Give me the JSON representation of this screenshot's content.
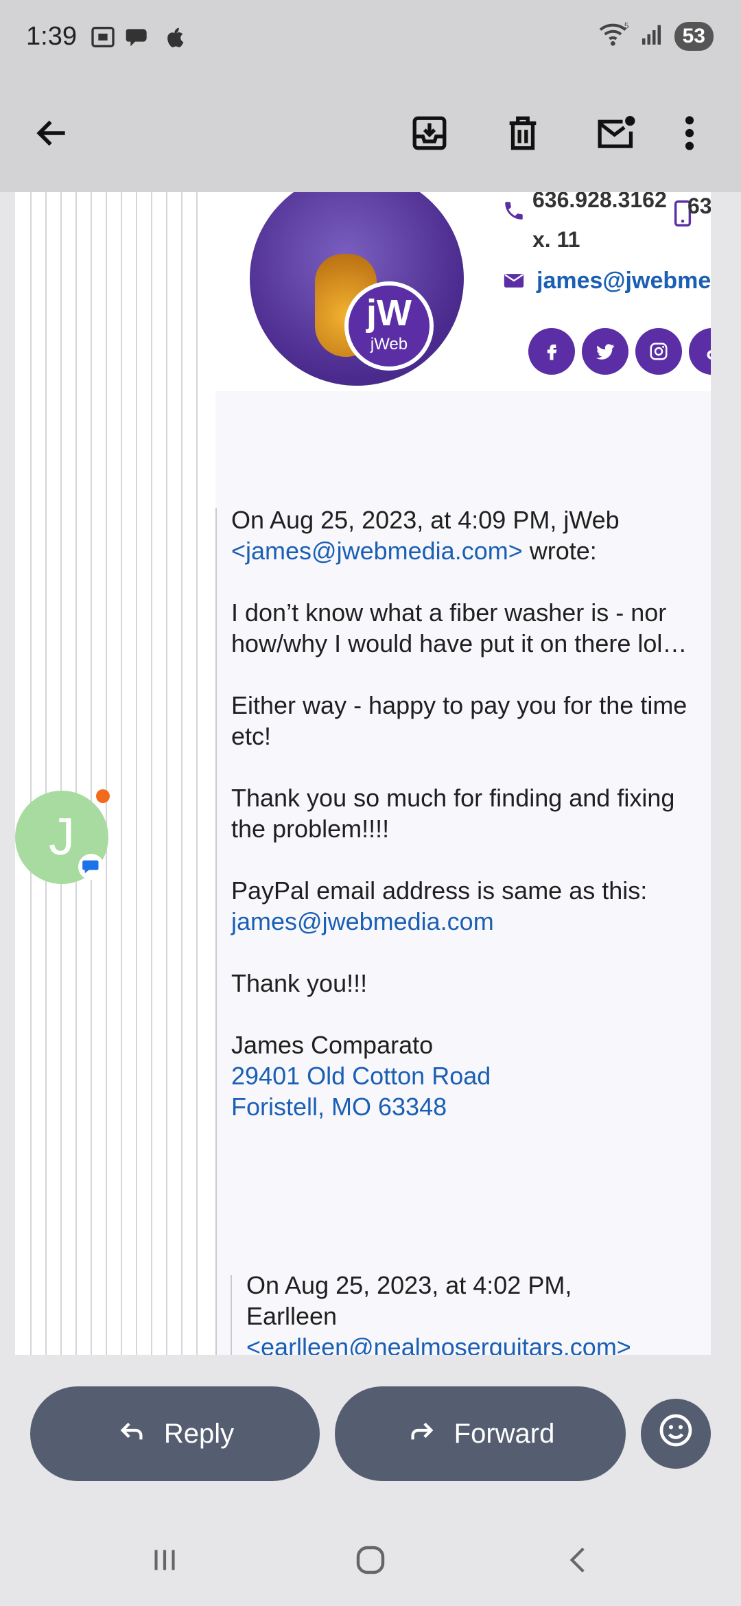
{
  "status_bar": {
    "time": "1:39",
    "battery": "53",
    "wifi_badge": "5",
    "left_icons": [
      "screenshot-icon",
      "chat-icon",
      "apple-icon"
    ],
    "right_icons": [
      "wifi-icon",
      "signal-icon"
    ]
  },
  "toolbar": {
    "back_icon": "arrow-left-icon",
    "actions": [
      "archive-icon",
      "delete-icon",
      "mark-unread-icon",
      "more-vert-icon"
    ]
  },
  "signature_card": {
    "phone": "636.928.3162",
    "extension": "x. 11",
    "mobile": "63",
    "email": "james@jwebmedia",
    "badge_logo": "jW",
    "badge_text": "jWeb",
    "social": [
      "f",
      "t",
      "ig",
      "tt"
    ]
  },
  "message": {
    "header_line1": "On Aug 25, 2023, at 4:09 PM, jWeb",
    "header_email": "<james@jwebmedia.com>",
    "header_wrote": " wrote:",
    "p1": "I don’t know what a fiber washer is - nor how/why I would have put it on there lol…",
    "p2": "Either way - happy to pay you for the time etc!",
    "p3": "Thank you so much for finding and fixing the problem!!!!",
    "p4": "PayPal email address is same as this:",
    "p4_link": "james@jwebmedia.com",
    "p5": "Thank you!!!",
    "sig_name": "James Comparato",
    "sig_address1": "29401 Old Cotton Road",
    "sig_address2": "Foristell, MO 63348"
  },
  "nested_quote": {
    "line1": "On Aug 25, 2023, at 4:02 PM,",
    "line2": "Earlleen",
    "line3": "<earlleen@nealmoserguitars.com>"
  },
  "avatar": {
    "initial": "J",
    "color": "#a8dba0"
  },
  "actions": {
    "reply_label": "Reply",
    "forward_label": "Forward"
  },
  "colors": {
    "link": "#1a5fb4",
    "button": "#555e70",
    "brand_purple": "#5b2ea6"
  }
}
